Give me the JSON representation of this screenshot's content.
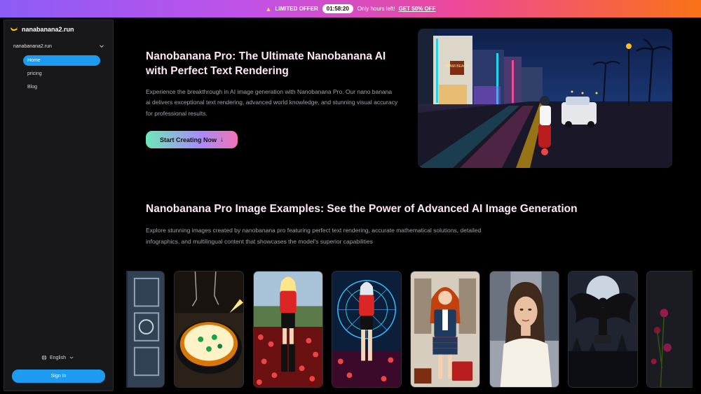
{
  "promo": {
    "badge": "LIMITED OFFER",
    "timer": "01:58:20",
    "note": "Only hours left!",
    "offer": "GET 50% OFF"
  },
  "sidebar": {
    "brand": "nanabanana2.run",
    "site": "nanabanana2.run",
    "items": [
      {
        "label": "Home",
        "active": true
      },
      {
        "label": "pricing",
        "active": false
      },
      {
        "label": "Blog",
        "active": false
      }
    ],
    "language": "English",
    "signin": "Sign In"
  },
  "hero": {
    "title": "Nanobanana Pro: The Ultimate Nanobanana AI with Perfect Text Rendering",
    "description": "Experience the breakthrough in AI image generation with Nanobanana Pro. Our nano banana ai delivers exceptional text rendering, advanced world knowledge, and stunning visual accuracy for professional results.",
    "cta": "Start Creating Now",
    "image_sign": "MIAMI BEACH"
  },
  "examples": {
    "title": "Nanobanana Pro Image Examples: See the Power of Advanced AI Image Generation",
    "description": "Explore stunning images created by nanobanana pro featuring perfect text rendering, accurate mathematical solutions, detailed infographics, and multilingual content that showcases the model's superior capabilities"
  },
  "colors": {
    "accent": "#1d9bf0",
    "title": "#fce7f3",
    "muted": "#a1a1aa"
  }
}
